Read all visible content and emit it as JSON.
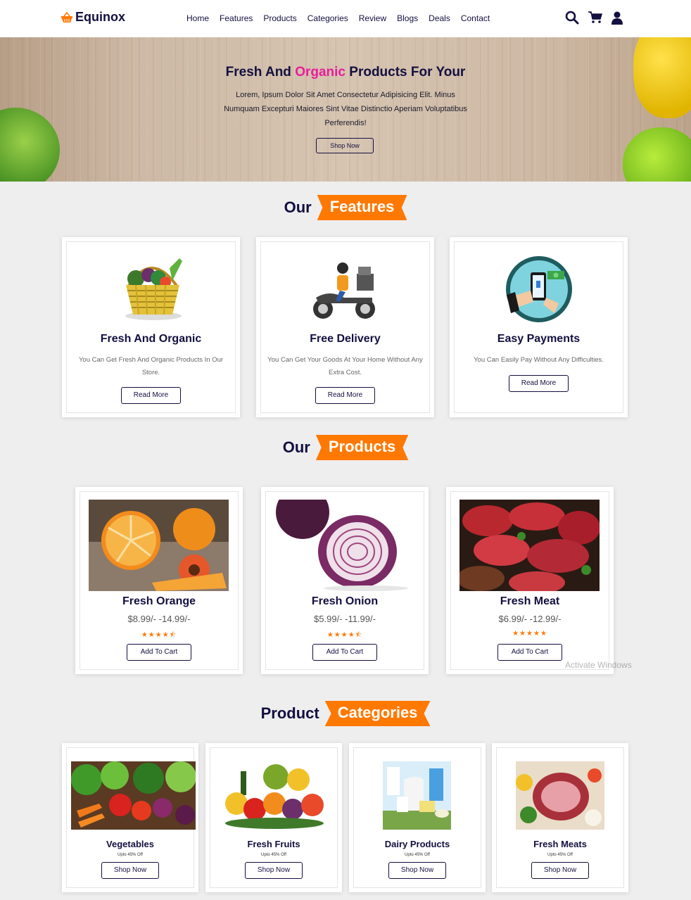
{
  "header": {
    "brand": "Equinox",
    "nav": [
      "Home",
      "Features",
      "Products",
      "Categories",
      "Review",
      "Blogs",
      "Deals",
      "Contact"
    ],
    "icons": [
      "search-icon",
      "cart-icon",
      "user-icon"
    ]
  },
  "hero": {
    "title_before": "Fresh And ",
    "title_accent": "Organic",
    "title_after": " Products For Your",
    "text": "Lorem, Ipsum Dolor Sit Amet Consectetur Adipisicing Elit. Minus Numquam Excepturi Maiores Sint Vitae Distinctio Aperiam Voluptatibus Perferendis!",
    "button": "Shop Now"
  },
  "features": {
    "heading_plain": "Our",
    "heading_tag": "Features",
    "cards": [
      {
        "title": "Fresh And Organic",
        "text": "You Can Get Fresh And Organic Products In Our Store.",
        "button": "Read More"
      },
      {
        "title": "Free Delivery",
        "text": "You Can Get Your Goods At Your Home Without Any Extra Cost.",
        "button": "Read More"
      },
      {
        "title": "Easy Payments",
        "text": "You Can Easily Pay Without Any Difficulties.",
        "button": "Read More"
      }
    ]
  },
  "products": {
    "heading_plain": "Our",
    "heading_tag": "Products",
    "items": [
      {
        "name": "Fresh Orange",
        "price": "$8.99/- -14.99/-",
        "rating": 4.5,
        "stars": "★★★★⯪",
        "button": "Add To Cart"
      },
      {
        "name": "Fresh Onion",
        "price": "$5.99/- -11.99/-",
        "rating": 4.5,
        "stars": "★★★★⯪",
        "button": "Add To Cart"
      },
      {
        "name": "Fresh Meat",
        "price": "$6.99/- -12.99/-",
        "rating": 5,
        "stars": "★★★★★",
        "button": "Add To Cart"
      }
    ]
  },
  "categories": {
    "heading_plain": "Product",
    "heading_tag": "Categories",
    "items": [
      {
        "name": "Vegetables",
        "offer": "Upto 45% Off",
        "button": "Shop Now"
      },
      {
        "name": "Fresh Fruits",
        "offer": "Upto 45% Off",
        "button": "Shop Now"
      },
      {
        "name": "Dairy Products",
        "offer": "Upto 45% Off",
        "button": "Shop Now"
      },
      {
        "name": "Fresh Meats",
        "offer": "Upto 45% Off",
        "button": "Shop Now"
      }
    ]
  },
  "watermark": {
    "line1": "Activate Windows"
  },
  "colors": {
    "accent": "#ff7800",
    "dark": "#130f40",
    "hero_accent": "#e81e9b"
  }
}
